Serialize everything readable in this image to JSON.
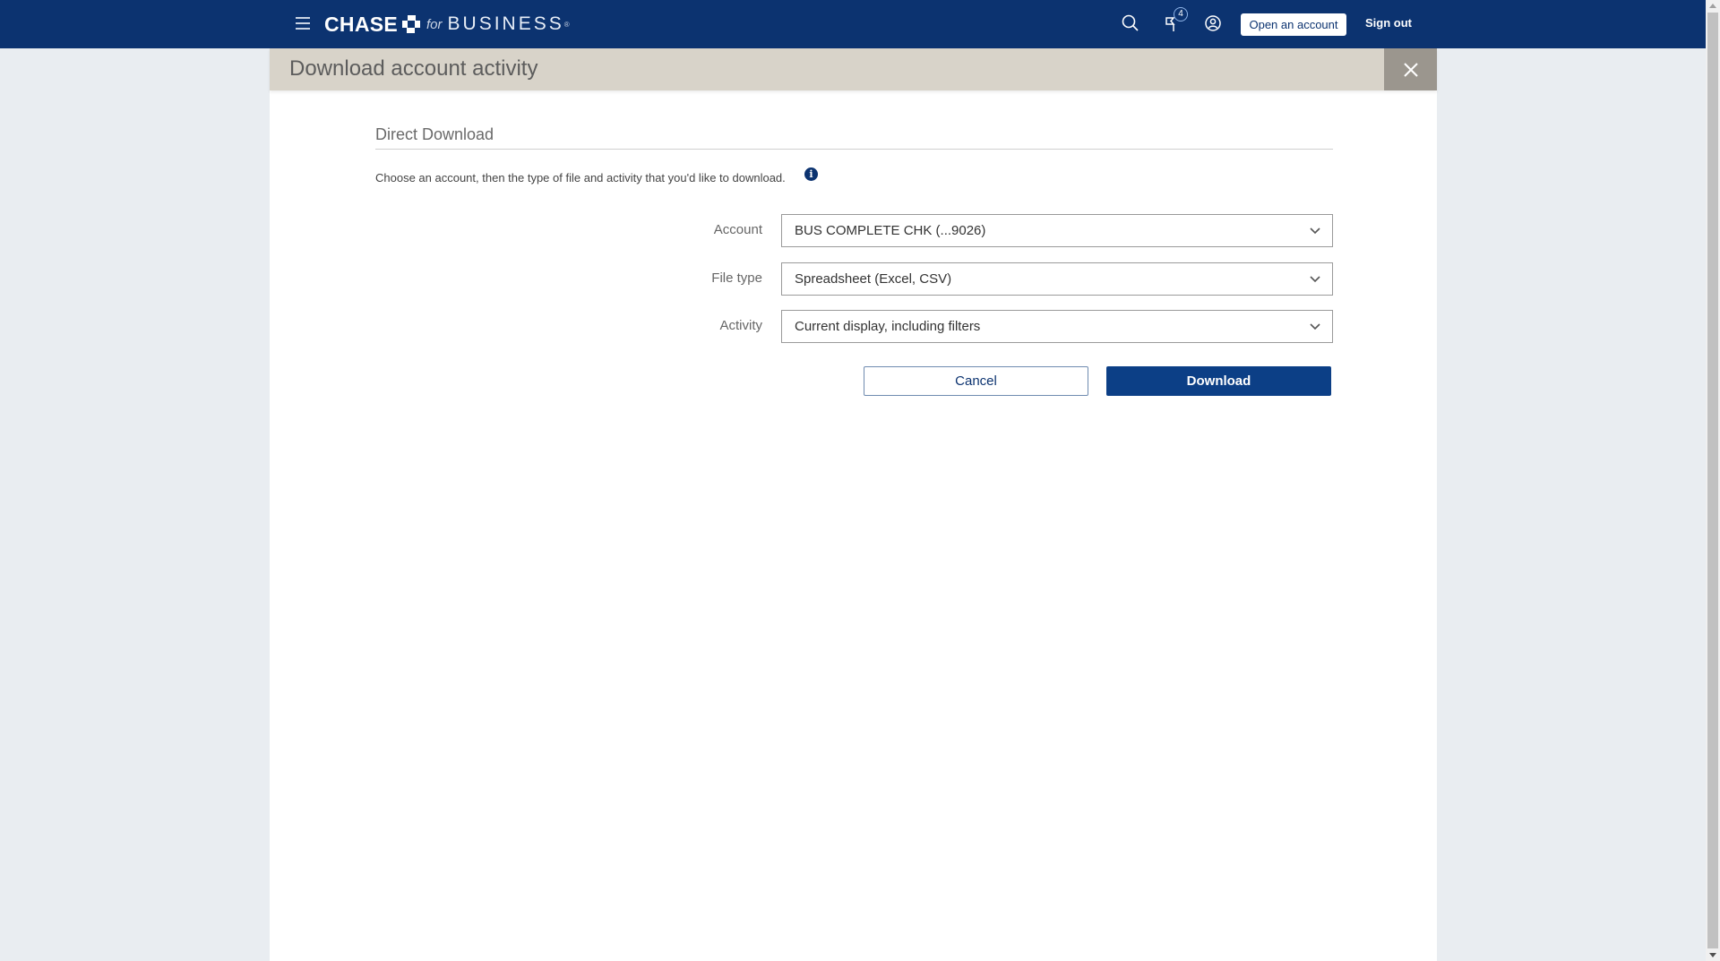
{
  "header": {
    "brand_name": "CHASE",
    "brand_for": "for",
    "brand_business": "BUSINESS",
    "brand_reg": "®",
    "menu_icon": "hamburger-menu-icon",
    "search_icon": "search-icon",
    "notifications_icon": "flag-notifications-icon",
    "notifications_count": "4",
    "profile_icon": "profile-icon",
    "open_account_label": "Open an account",
    "sign_out_label": "Sign out"
  },
  "dialog": {
    "title": "Download account activity",
    "close_icon": "close-icon",
    "section_title": "Direct Download",
    "intro_text": "Choose an account, then the type of file and activity that you'd like to download.",
    "info_icon": "i",
    "fields": [
      {
        "label": "Account",
        "value": "BUS COMPLETE CHK (...9026)"
      },
      {
        "label": "File type",
        "value": "Spreadsheet (Excel, CSV)"
      },
      {
        "label": "Activity",
        "value": "Current display, including filters"
      }
    ],
    "cancel_label": "Cancel",
    "download_label": "Download"
  },
  "colors": {
    "brand_navy": "#0c3370",
    "header_beige": "#d8d3c9",
    "close_gray": "#9b968e",
    "download_blue": "#0c3f86",
    "page_bg": "#e9edf1"
  }
}
